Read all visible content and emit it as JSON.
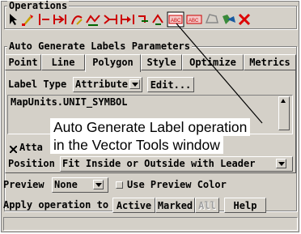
{
  "operations_group": {
    "title": "Operations",
    "icons": [
      "select-pointer-icon",
      "draw-tool-icon",
      "line-segment-icon",
      "measure-line-icon",
      "curve-tool-icon",
      "vertex-tool-icon",
      "arrow-right-line-icon",
      "arrow-line-icon",
      "join-tool-icon",
      "split-tool-icon",
      "auto-generate-label-icon",
      "label-edit-icon",
      "polygon-fill-icon",
      "color-tool-icon",
      "delete-x-icon"
    ],
    "active_icon": "auto-generate-label-icon"
  },
  "params_group": {
    "title": "Auto Generate Labels Parameters",
    "tabs": [
      "Point",
      "Line",
      "Polygon",
      "Style",
      "Optimize",
      "Metrics"
    ],
    "active_tab": "Polygon"
  },
  "label_type": {
    "label": "Label Type",
    "value": "Attribute",
    "edit_button": "Edit..."
  },
  "attribute_field": {
    "value": "MapUnits.UNIT_SYMBOL"
  },
  "attach_checkbox": {
    "label_visible": "Atta",
    "checked": true
  },
  "position": {
    "label": "Position",
    "value": "Fit Inside or Outside with Leader"
  },
  "preview": {
    "label": "Preview",
    "value": "None",
    "checkbox_label": "Use Preview Color",
    "checked": false
  },
  "apply": {
    "label": "Apply operation to",
    "active": "Active",
    "marked": "Marked",
    "all": "All",
    "help": "Help"
  },
  "callout": {
    "line1": "Auto Generate Label operation",
    "line2": "in the Vector Tools window"
  }
}
